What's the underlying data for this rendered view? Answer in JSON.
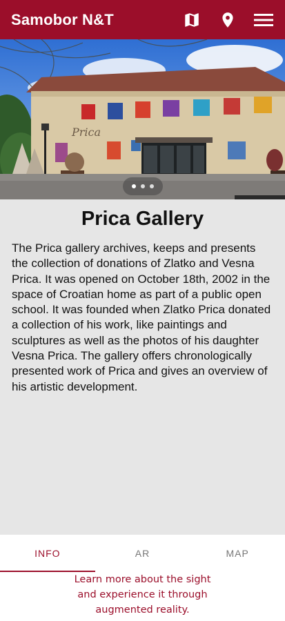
{
  "app_bar": {
    "title": "Samobor N&T",
    "actions": [
      {
        "icon": "map-icon"
      },
      {
        "icon": "location-pin-icon"
      },
      {
        "icon": "hamburger-menu-icon"
      }
    ],
    "background": "#9b0e2a"
  },
  "hero": {
    "building_sign": "Prica",
    "carousel": {
      "count": 3,
      "active_index": 0
    }
  },
  "sight": {
    "title": "Prica Gallery",
    "description": "The Prica gallery archives, keeps and presents the collection of donations of Zlatko and Vesna Prica. It was opened on October 18th, 2002 in the space of Croatian home as part of a public open school.  It was founded when Zlatko Prica donated a collection of his work, like paintings and sculptures as well as the photos of his daughter Vesna Prica. The gallery offers chronologically presented work of Prica and gives an overview of his artistic development."
  },
  "tabs": [
    {
      "label": "INFO",
      "active": true
    },
    {
      "label": "AR",
      "active": false
    },
    {
      "label": "MAP",
      "active": false
    }
  ],
  "promo": {
    "line1": "Learn more about the sight",
    "line2": "and experience it through",
    "line3": "augmented reality."
  },
  "colors": {
    "accent": "#9b0e2a",
    "content_background": "#e6e6e6"
  }
}
